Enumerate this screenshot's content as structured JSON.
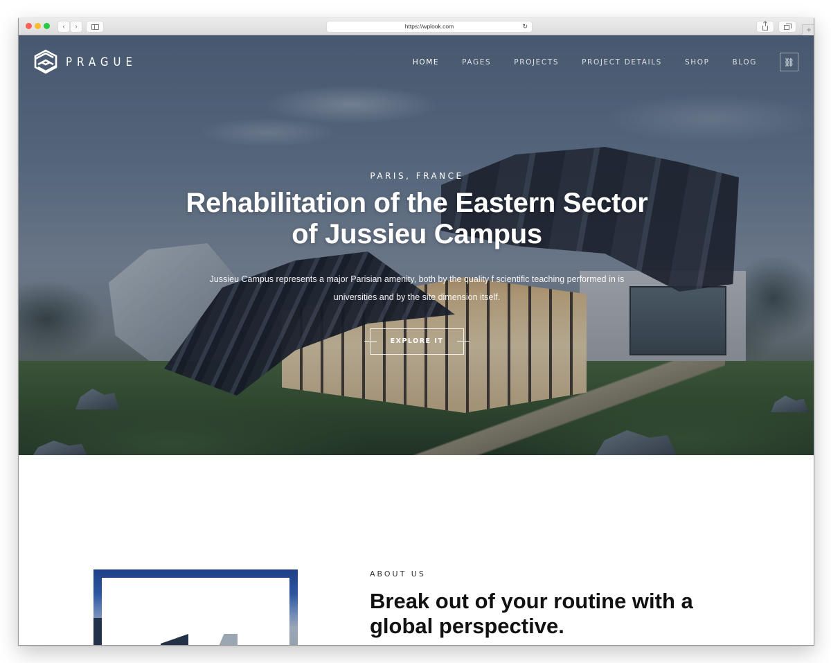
{
  "browser": {
    "url": "https://wplook.com",
    "icons": {
      "back": "chevron-left-icon",
      "forward": "chevron-right-icon",
      "sidebar": "sidebar-icon",
      "reload": "reload-icon",
      "share": "share-icon",
      "tabs": "tabs-icon",
      "new_tab": "plus-icon"
    },
    "glyphs": {
      "back": "‹",
      "forward": "›",
      "reload": "↻",
      "new_tab": "+"
    }
  },
  "site": {
    "logo_text": "PRAGUE",
    "nav": [
      {
        "label": "HOME",
        "active": true
      },
      {
        "label": "PAGES",
        "active": false
      },
      {
        "label": "PROJECTS",
        "active": false
      },
      {
        "label": "PROJECT DETAILS",
        "active": false
      },
      {
        "label": "SHOP",
        "active": false
      },
      {
        "label": "BLOG",
        "active": false
      }
    ],
    "nav_icon": {
      "name": "link-icon",
      "glyph": "⛓"
    }
  },
  "hero": {
    "kicker": "PARIS, FRANCE",
    "title": "Rehabilitation of the Eastern Sector of Jussieu Campus",
    "description": "Jussieu Campus represents a major Parisian amenity, both by the quality f scientific teaching performed in is universities and by the site dimension itself.",
    "button_label": "EXPLORE IT"
  },
  "about": {
    "kicker": "ABOUT US",
    "title": "Break out of your routine with a global perspective."
  }
}
